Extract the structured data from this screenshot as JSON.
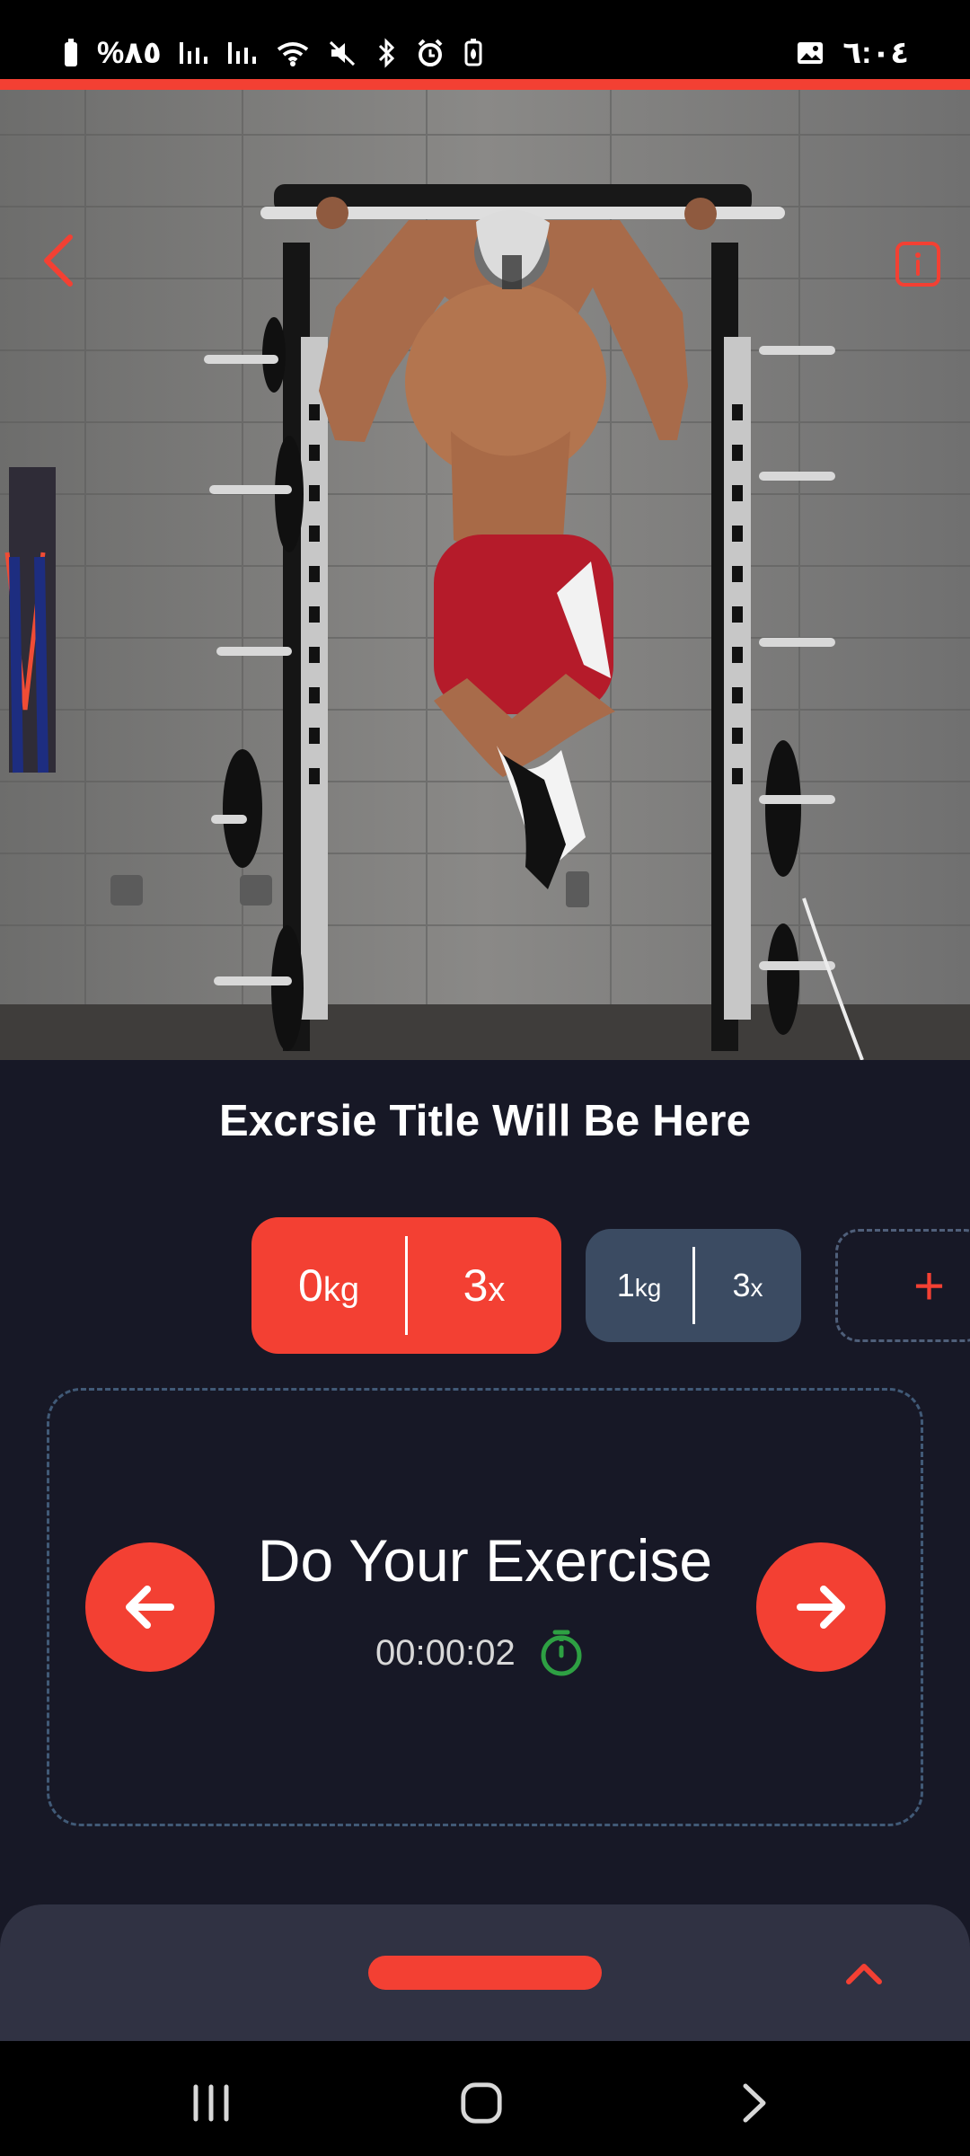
{
  "status_bar": {
    "battery_percent": "%٨٥",
    "time": "٦:٠٤",
    "icons": [
      "battery-icon",
      "signal-icon",
      "signal-icon",
      "wifi-icon",
      "mute-icon",
      "bluetooth-icon",
      "alarm-icon",
      "battery-saver-icon",
      "image-icon"
    ]
  },
  "colors": {
    "accent": "#f34033",
    "background": "#171826",
    "chip_inactive": "#3b4b62",
    "card_border": "#415a77",
    "timer_icon": "#2ea043",
    "sheet": "#303243"
  },
  "header": {
    "back_icon": "back-chevron-icon",
    "info_icon": "info-icon"
  },
  "exercise": {
    "title": "Excrsie Title Will Be Here"
  },
  "sets": [
    {
      "weight": "0",
      "weight_unit": "kg",
      "reps": "3",
      "reps_unit": "x",
      "active": true
    },
    {
      "weight": "1",
      "weight_unit": "kg",
      "reps": "3",
      "reps_unit": "x",
      "active": false
    }
  ],
  "add_set": {
    "label": "+"
  },
  "exercise_card": {
    "heading": "Do Your Exercise",
    "timer": "00:00:02",
    "prev_icon": "arrow-left-icon",
    "next_icon": "arrow-right-icon",
    "timer_icon": "stopwatch-icon"
  },
  "bottom_sheet": {
    "up_icon": "chevron-up-icon"
  },
  "android_nav": {
    "recent": "recent-apps-icon",
    "home": "home-icon",
    "back": "back-icon"
  }
}
